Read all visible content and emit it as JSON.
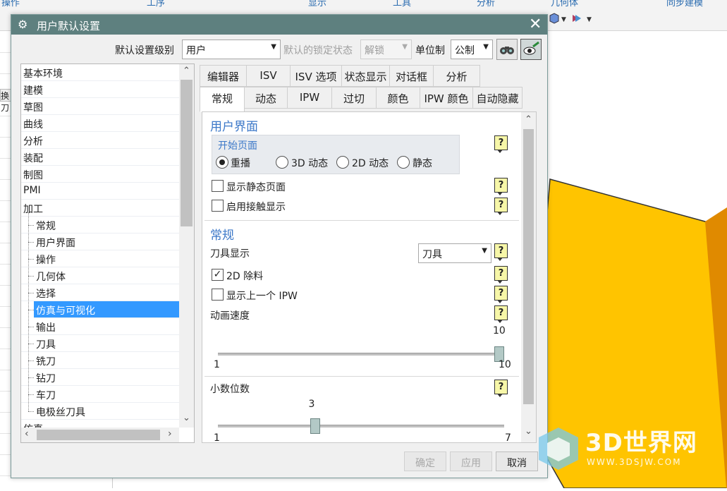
{
  "background": {
    "top_labels": [
      "操作",
      "工序",
      "显示",
      "工具",
      "分析",
      "几何体",
      "同步建模"
    ],
    "left_tag": "换刀",
    "colors": {
      "part_top": "#ffc400",
      "part_side": "#e08a00",
      "part_edge": "#333333"
    }
  },
  "watermark": {
    "text": "3D世界网",
    "url": "WWW.3DSJW.COM"
  },
  "dialog": {
    "title": "用户默认设置",
    "close_icon": "close-icon",
    "settings_level_label": "默认设置级别",
    "settings_level_value": "用户",
    "lock_state_label": "默认的锁定状态",
    "lock_state_value": "解锁",
    "units_label": "单位制",
    "units_value": "公制",
    "tree": {
      "items": [
        {
          "label": "基本环境",
          "level": 0
        },
        {
          "label": "建模",
          "level": 0
        },
        {
          "label": "草图",
          "level": 0
        },
        {
          "label": "曲线",
          "level": 0
        },
        {
          "label": "分析",
          "level": 0
        },
        {
          "label": "装配",
          "level": 0
        },
        {
          "label": "制图",
          "level": 0
        },
        {
          "label": "PMI",
          "level": 0
        },
        {
          "label": "加工",
          "level": 0
        },
        {
          "label": "常规",
          "level": 1
        },
        {
          "label": "用户界面",
          "level": 1
        },
        {
          "label": "操作",
          "level": 1
        },
        {
          "label": "几何体",
          "level": 1
        },
        {
          "label": "选择",
          "level": 1
        },
        {
          "label": "仿真与可视化",
          "level": 1,
          "selected": true
        },
        {
          "label": "输出",
          "level": 1
        },
        {
          "label": "刀具",
          "level": 1
        },
        {
          "label": "铣刀",
          "level": 1
        },
        {
          "label": "钻刀",
          "level": 1
        },
        {
          "label": "车刀",
          "level": 1
        },
        {
          "label": "电极丝刀具",
          "level": 1
        },
        {
          "label": "仿真",
          "level": 0
        }
      ]
    },
    "tabs_row1": [
      "编辑器",
      "ISV",
      "ISV 选项",
      "状态显示",
      "对话框",
      "分析"
    ],
    "tabs_row2": [
      "常规",
      "动态",
      "IPW",
      "过切",
      "颜色",
      "IPW 颜色",
      "自动隐藏"
    ],
    "active_tab": "常规",
    "panel": {
      "ui_section_title": "用户界面",
      "start_page_title": "开始页面",
      "radios": [
        {
          "label": "重播",
          "checked": true
        },
        {
          "label": "3D 动态",
          "checked": false
        },
        {
          "label": "2D 动态",
          "checked": false
        },
        {
          "label": "静态",
          "checked": false
        }
      ],
      "show_static_page": {
        "label": "显示静态页面",
        "checked": false
      },
      "enable_touch": {
        "label": "启用接触显示",
        "checked": false
      },
      "general_section_title": "常规",
      "tool_display_label": "刀具显示",
      "tool_display_value": "刀具",
      "material_2d": {
        "label": "2D 除料",
        "checked": true
      },
      "show_prev_ipw": {
        "label": "显示上一个 IPW",
        "checked": false
      },
      "anim_speed": {
        "label": "动画速度",
        "value": "10",
        "min": "1",
        "max": "10",
        "fraction": 1.0
      },
      "decimals": {
        "label": "小数位数",
        "value": "3",
        "min": "1",
        "max": "7",
        "fraction": 0.333
      },
      "help_glyph": "?"
    },
    "buttons": {
      "ok": "确定",
      "apply": "应用",
      "cancel": "取消"
    }
  }
}
